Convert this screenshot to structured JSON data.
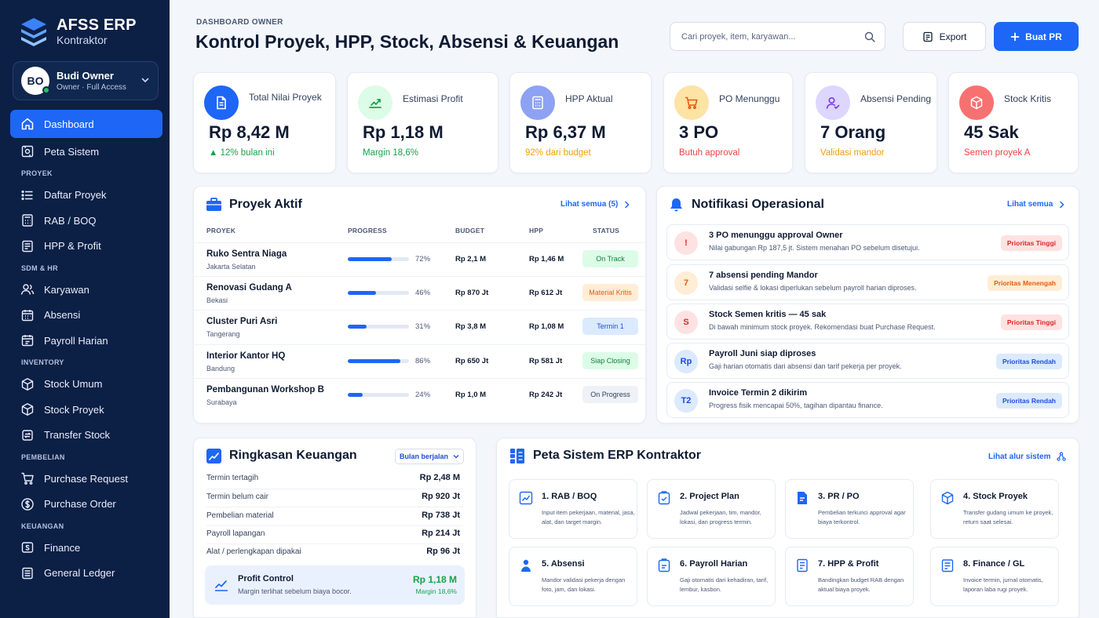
{
  "sidebar": {
    "brand_title": "AFSS ERP",
    "brand_sub": "Kontraktor",
    "user": {
      "initials": "BO",
      "name": "Budi Owner",
      "role": "Owner · Full Access"
    },
    "nav": {
      "dashboard": "Dashboard",
      "peta_sistem": "Peta Sistem",
      "sec_proyek": "PROYEK",
      "daftar_proyek": "Daftar Proyek",
      "rab_boq": "RAB / BOQ",
      "hpp_profit": "HPP & Profit",
      "sec_sdm": "SDM & HR",
      "karyawan": "Karyawan",
      "absensi": "Absensi",
      "payroll_harian": "Payroll Harian",
      "sec_inventory": "INVENTORY",
      "stock_umum": "Stock Umum",
      "stock_proyek": "Stock Proyek",
      "transfer_stock": "Transfer Stock",
      "sec_pembelian": "PEMBELIAN",
      "purchase_request": "Purchase Request",
      "purchase_order": "Purchase Order",
      "sec_keuangan": "KEUANGAN",
      "finance": "Finance",
      "general_ledger": "General Ledger"
    }
  },
  "header": {
    "eyebrow": "DASHBOARD OWNER",
    "title": "Kontrol Proyek, HPP, Stock, Absensi & Keuangan",
    "search_placeholder": "Cari proyek, item, karyawan...",
    "export_label": "Export",
    "buat_pr_label": "Buat PR"
  },
  "kpis": [
    {
      "label": "Total Nilai Proyek",
      "value": "Rp  8,42 M",
      "sub": "12% bulan ini",
      "icon": "document-icon",
      "color": "#1e66f5"
    },
    {
      "label": "Estimasi Profit",
      "value": "Rp  1,18 M",
      "sub": "Margin 18,6%",
      "icon": "chart-up-icon",
      "color": "#16a34a"
    },
    {
      "label": "HPP Aktual",
      "value": "Rp 6,37 M",
      "sub": "92% dari budget",
      "icon": "calculator-icon",
      "color": "#f59e0b"
    },
    {
      "label": "PO Menunggu",
      "value": "3 PO",
      "sub": "Butuh approval",
      "icon": "cart-icon",
      "color": "#ef4444"
    },
    {
      "label": "Absensi Pending",
      "value": "7 Orang",
      "sub": "Validasi mandor",
      "icon": "user-check-icon",
      "color": "#f59e0b"
    },
    {
      "label": "Stock Kritis",
      "value": "45 Sak",
      "sub": "Semen proyek A",
      "icon": "box-icon",
      "color": "#ef4444"
    }
  ],
  "proyek_aktif": {
    "title": "Proyek Aktif",
    "link": "Lihat semua (5)",
    "columns": [
      "PROYEK",
      "PROGRESS",
      "BUDGET",
      "HPP",
      "STATUS"
    ],
    "rows": [
      {
        "name": "Ruko Sentra Niaga",
        "location": "Jakarta Selatan",
        "progress": 72,
        "progress_label": "72%",
        "budget": "Rp 2,1 M",
        "hpp": "Rp 1,46 M",
        "status": "On Track",
        "status_bg": "#dcfce7",
        "status_fg": "#15803d"
      },
      {
        "name": "Renovasi Gudang A",
        "location": "Bekasi",
        "progress": 46,
        "progress_label": "46%",
        "budget": "Rp 870 Jt",
        "hpp": "Rp 612 Jt",
        "status": "Material Kritis",
        "status_bg": "#ffedd5",
        "status_fg": "#ea580c"
      },
      {
        "name": "Cluster Puri Asri",
        "location": "Tangerang",
        "progress": 31,
        "progress_label": "31%",
        "budget": "Rp 3,8 M",
        "hpp": "Rp 1,08 M",
        "status": "Termin 1",
        "status_bg": "#dbeafe",
        "status_fg": "#1d4ed8"
      },
      {
        "name": "Interior Kantor HQ",
        "location": "Bandung",
        "progress": 86,
        "progress_label": "86%",
        "budget": "Rp 650 Jt",
        "hpp": "Rp 581 Jt",
        "status": "Siap Closing",
        "status_bg": "#dcfce7",
        "status_fg": "#15803d"
      },
      {
        "name": "Pembangunan Workshop B",
        "location": "Surabaya",
        "progress": 24,
        "progress_label": "24%",
        "budget": "Rp 1,0 M",
        "hpp": "Rp 242 Jt",
        "status": "On Progress",
        "status_bg": "#eef1f6",
        "status_fg": "#33415c"
      }
    ]
  },
  "notifikasi": {
    "title": "Notifikasi Operasional",
    "link": "Lihat semua",
    "items": [
      {
        "icon": "!",
        "icon_bg": "#fee2e2",
        "icon_fg": "#dc2626",
        "title": "3 PO menunggu approval Owner",
        "desc": "Nilai gabungan Rp 187,5 jt. Sistem menahan PO sebelum disetujui.",
        "badge": "Prioritas Tinggi",
        "badge_bg": "#fee2e2",
        "badge_fg": "#dc2626"
      },
      {
        "icon": "7",
        "icon_bg": "#ffedd5",
        "icon_fg": "#ea580c",
        "title": "7 absensi pending Mandor",
        "desc": "Validasi selfie & lokasi diperlukan sebelum payroll harian diproses.",
        "badge": "Prioritas Menengah",
        "badge_bg": "#ffedd5",
        "badge_fg": "#ea580c"
      },
      {
        "icon": "S",
        "icon_bg": "#fee2e2",
        "icon_fg": "#dc2626",
        "title": "Stock Semen kritis — 45 sak",
        "desc": "Di bawah minimum stock proyek. Rekomendasi buat Purchase Request.",
        "badge": "Prioritas Tinggi",
        "badge_bg": "#fee2e2",
        "badge_fg": "#dc2626"
      },
      {
        "icon": "Rp",
        "icon_bg": "#dbeafe",
        "icon_fg": "#1d4ed8",
        "title": "Payroll Juni siap diproses",
        "desc": "Gaji harian otomatis dari absensi dan tarif pekerja per proyek.",
        "badge": "Prioritas Rendah",
        "badge_bg": "#dbeafe",
        "badge_fg": "#1d4ed8"
      },
      {
        "icon": "T2",
        "icon_bg": "#dbeafe",
        "icon_fg": "#1d4ed8",
        "title": "Invoice Termin 2 dikirim",
        "desc": "Progress fisik mencapai 50%, tagihan dipantau finance.",
        "badge": "Prioritas Rendah",
        "badge_bg": "#dbeafe",
        "badge_fg": "#1d4ed8"
      }
    ]
  },
  "keuangan": {
    "title": "Ringkasan Keuangan",
    "period": "Bulan berjalan",
    "rows": [
      {
        "label": "Termin tertagih",
        "value": "Rp 2,48 M"
      },
      {
        "label": "Termin belum cair",
        "value": "Rp 920 Jt"
      },
      {
        "label": "Pembelian material",
        "value": "Rp 738 Jt"
      },
      {
        "label": "Payroll lapangan",
        "value": "Rp 214 Jt"
      },
      {
        "label": "Alat / perlengkapan dipakai",
        "value": "Rp 96 Jt"
      }
    ],
    "profit_control": {
      "title": "Profit Control",
      "desc": "Margin terlihat sebelum biaya bocor.",
      "value": "Rp 1,18 M",
      "margin": "Margin 18,6%"
    }
  },
  "peta_sistem": {
    "title": "Peta Sistem ERP Kontraktor",
    "link": "Lihat alur sistem",
    "modules": [
      {
        "title": "1. RAB / BOQ",
        "desc": "Input item pekerjaan, material, jasa, alat, dan target margin.",
        "icon": "chart-doc-icon"
      },
      {
        "title": "2. Project Plan",
        "desc": "Jadwal pekerjaan, tim, mandor, lokasi, dan progress termin.",
        "icon": "clipboard-icon"
      },
      {
        "title": "3. PR / PO",
        "desc": "Pembelian terkunci approval agar biaya terkontrol.",
        "icon": "purchase-doc-icon"
      },
      {
        "title": "4. Stock Proyek",
        "desc": "Transfer gudang umum ke proyek, return saat selesai.",
        "icon": "box-icon"
      },
      {
        "title": "5. Absensi",
        "desc": "Mandor validasi pekerja dengan foto, jam, dan lokasi.",
        "icon": "worker-icon"
      },
      {
        "title": "6. Payroll Harian",
        "desc": "Gaji otomatis dari kehadiran, tarif, lembur, kasbon.",
        "icon": "payroll-icon"
      },
      {
        "title": "7. HPP & Profit",
        "desc": "Bandingkan budget RAB dengan aktual biaya proyek.",
        "icon": "report-icon"
      },
      {
        "title": "8. Finance / GL",
        "desc": "Invoice termin, jurnal otomatis, laporan laba rugi proyek.",
        "icon": "ledger-icon"
      }
    ]
  }
}
